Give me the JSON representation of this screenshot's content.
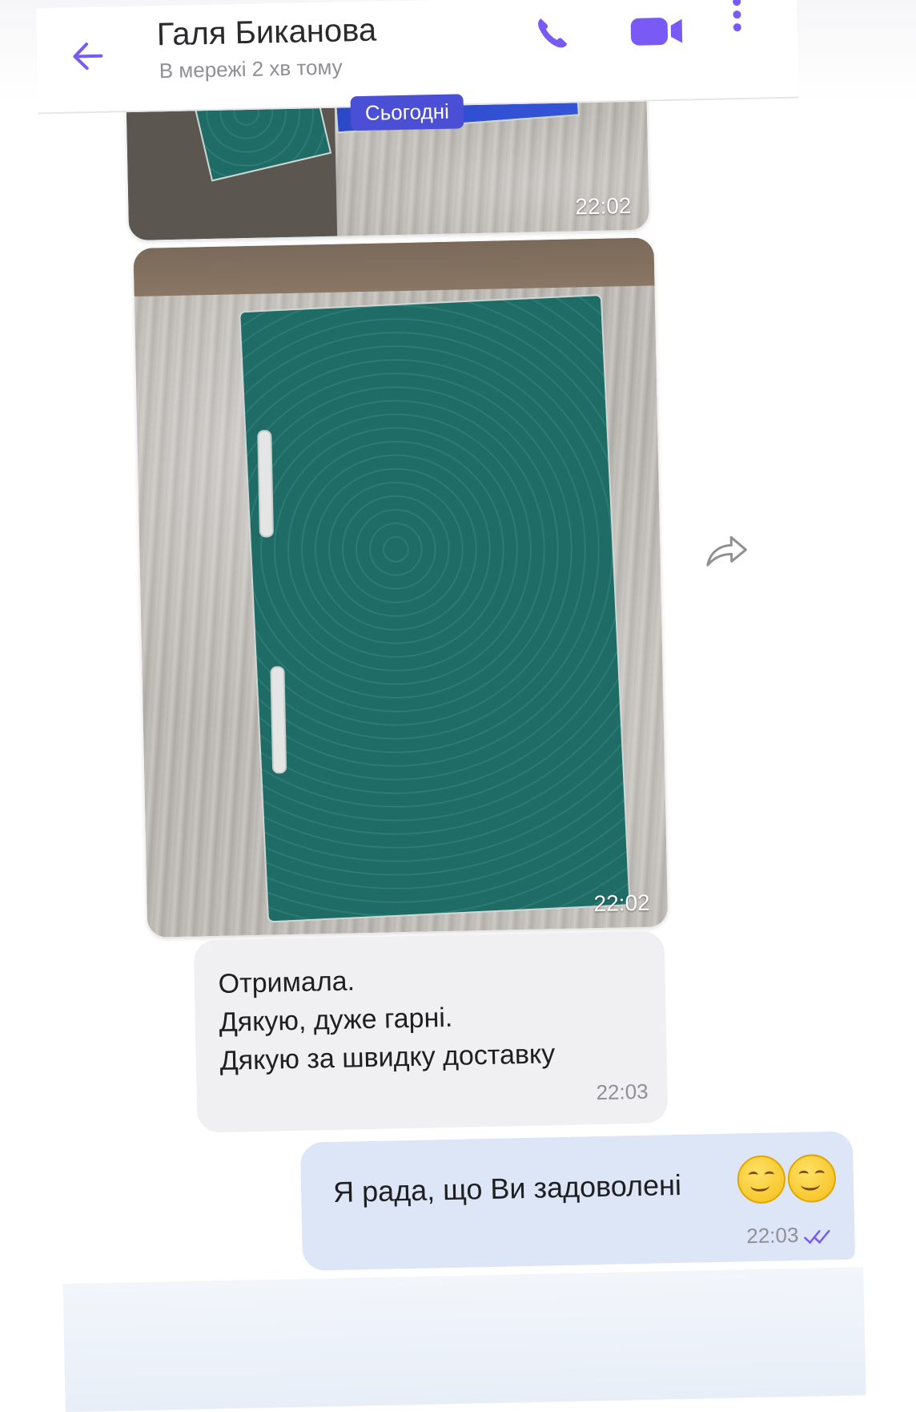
{
  "header": {
    "contact_name": "Галя Биканова",
    "status": "В мережі 2 хв тому"
  },
  "chat": {
    "date_label": "Сьогодні",
    "messages": [
      {
        "type": "photo",
        "time": "22:02"
      },
      {
        "type": "photo",
        "time": "22:02"
      },
      {
        "type": "text_in",
        "lines": [
          "Отримала.",
          "Дякую, дуже гарні.",
          "Дякую за швидку доставку"
        ],
        "time": "22:03"
      },
      {
        "type": "text_out",
        "text": "Я рада, що Ви задоволені",
        "emojis": [
          "smiling-face-emoji",
          "smiling-face-emoji"
        ],
        "time": "22:03",
        "read": true
      }
    ]
  },
  "colors": {
    "accent": "#7a5af5",
    "outgoing_bubble": "#dce6f6",
    "incoming_bubble": "#f0f0f2",
    "date_badge": "#4b4fd6"
  },
  "icons": {
    "back": "back-arrow-icon",
    "call": "phone-icon",
    "video": "video-camera-icon",
    "more": "more-vertical-icon",
    "forward": "forward-icon",
    "read": "double-check-icon"
  }
}
